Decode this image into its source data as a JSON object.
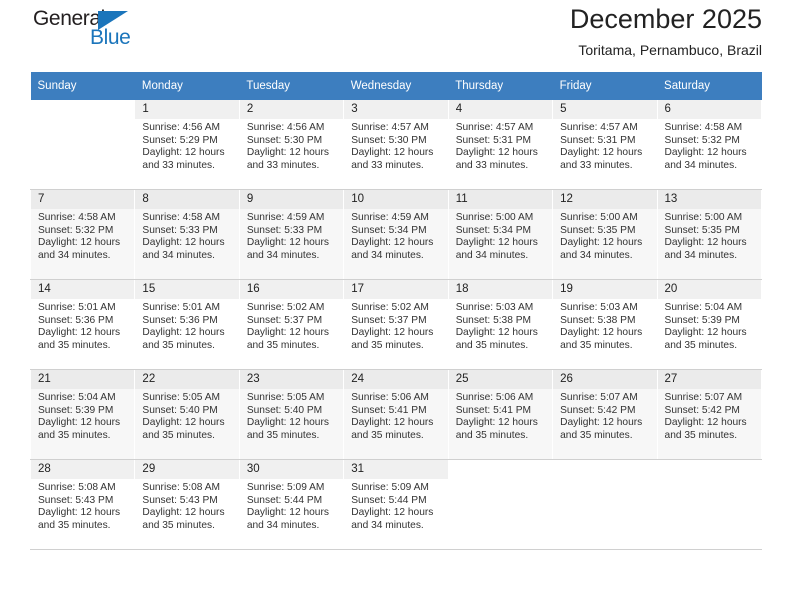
{
  "logo": {
    "word_one": "General",
    "word_two": "Blue",
    "triangle_color": "#1b75bb"
  },
  "header": {
    "title": "December 2025",
    "subtitle": "Toritama, Pernambuco, Brazil"
  },
  "theme": {
    "header_blue": "#3d7ebf",
    "daynum_band": "#f0f0f0",
    "row_shade": "#f7f7f7"
  },
  "labels": {
    "sunrise_prefix": "Sunrise:",
    "sunset_prefix": "Sunset:",
    "daylight_prefix": "Daylight:"
  },
  "weekdays": [
    "Sunday",
    "Monday",
    "Tuesday",
    "Wednesday",
    "Thursday",
    "Friday",
    "Saturday"
  ],
  "weeks": [
    {
      "shaded": false,
      "days": [
        {
          "num": "",
          "sunrise": "",
          "sunset": "",
          "daylight": "",
          "blank": true
        },
        {
          "num": "1",
          "sunrise": "Sunrise: 4:56 AM",
          "sunset": "Sunset: 5:29 PM",
          "daylight": "Daylight: 12 hours and 33 minutes."
        },
        {
          "num": "2",
          "sunrise": "Sunrise: 4:56 AM",
          "sunset": "Sunset: 5:30 PM",
          "daylight": "Daylight: 12 hours and 33 minutes."
        },
        {
          "num": "3",
          "sunrise": "Sunrise: 4:57 AM",
          "sunset": "Sunset: 5:30 PM",
          "daylight": "Daylight: 12 hours and 33 minutes."
        },
        {
          "num": "4",
          "sunrise": "Sunrise: 4:57 AM",
          "sunset": "Sunset: 5:31 PM",
          "daylight": "Daylight: 12 hours and 33 minutes."
        },
        {
          "num": "5",
          "sunrise": "Sunrise: 4:57 AM",
          "sunset": "Sunset: 5:31 PM",
          "daylight": "Daylight: 12 hours and 33 minutes."
        },
        {
          "num": "6",
          "sunrise": "Sunrise: 4:58 AM",
          "sunset": "Sunset: 5:32 PM",
          "daylight": "Daylight: 12 hours and 34 minutes."
        }
      ]
    },
    {
      "shaded": true,
      "days": [
        {
          "num": "7",
          "sunrise": "Sunrise: 4:58 AM",
          "sunset": "Sunset: 5:32 PM",
          "daylight": "Daylight: 12 hours and 34 minutes."
        },
        {
          "num": "8",
          "sunrise": "Sunrise: 4:58 AM",
          "sunset": "Sunset: 5:33 PM",
          "daylight": "Daylight: 12 hours and 34 minutes."
        },
        {
          "num": "9",
          "sunrise": "Sunrise: 4:59 AM",
          "sunset": "Sunset: 5:33 PM",
          "daylight": "Daylight: 12 hours and 34 minutes."
        },
        {
          "num": "10",
          "sunrise": "Sunrise: 4:59 AM",
          "sunset": "Sunset: 5:34 PM",
          "daylight": "Daylight: 12 hours and 34 minutes."
        },
        {
          "num": "11",
          "sunrise": "Sunrise: 5:00 AM",
          "sunset": "Sunset: 5:34 PM",
          "daylight": "Daylight: 12 hours and 34 minutes."
        },
        {
          "num": "12",
          "sunrise": "Sunrise: 5:00 AM",
          "sunset": "Sunset: 5:35 PM",
          "daylight": "Daylight: 12 hours and 34 minutes."
        },
        {
          "num": "13",
          "sunrise": "Sunrise: 5:00 AM",
          "sunset": "Sunset: 5:35 PM",
          "daylight": "Daylight: 12 hours and 34 minutes."
        }
      ]
    },
    {
      "shaded": false,
      "days": [
        {
          "num": "14",
          "sunrise": "Sunrise: 5:01 AM",
          "sunset": "Sunset: 5:36 PM",
          "daylight": "Daylight: 12 hours and 35 minutes."
        },
        {
          "num": "15",
          "sunrise": "Sunrise: 5:01 AM",
          "sunset": "Sunset: 5:36 PM",
          "daylight": "Daylight: 12 hours and 35 minutes."
        },
        {
          "num": "16",
          "sunrise": "Sunrise: 5:02 AM",
          "sunset": "Sunset: 5:37 PM",
          "daylight": "Daylight: 12 hours and 35 minutes."
        },
        {
          "num": "17",
          "sunrise": "Sunrise: 5:02 AM",
          "sunset": "Sunset: 5:37 PM",
          "daylight": "Daylight: 12 hours and 35 minutes."
        },
        {
          "num": "18",
          "sunrise": "Sunrise: 5:03 AM",
          "sunset": "Sunset: 5:38 PM",
          "daylight": "Daylight: 12 hours and 35 minutes."
        },
        {
          "num": "19",
          "sunrise": "Sunrise: 5:03 AM",
          "sunset": "Sunset: 5:38 PM",
          "daylight": "Daylight: 12 hours and 35 minutes."
        },
        {
          "num": "20",
          "sunrise": "Sunrise: 5:04 AM",
          "sunset": "Sunset: 5:39 PM",
          "daylight": "Daylight: 12 hours and 35 minutes."
        }
      ]
    },
    {
      "shaded": true,
      "days": [
        {
          "num": "21",
          "sunrise": "Sunrise: 5:04 AM",
          "sunset": "Sunset: 5:39 PM",
          "daylight": "Daylight: 12 hours and 35 minutes."
        },
        {
          "num": "22",
          "sunrise": "Sunrise: 5:05 AM",
          "sunset": "Sunset: 5:40 PM",
          "daylight": "Daylight: 12 hours and 35 minutes."
        },
        {
          "num": "23",
          "sunrise": "Sunrise: 5:05 AM",
          "sunset": "Sunset: 5:40 PM",
          "daylight": "Daylight: 12 hours and 35 minutes."
        },
        {
          "num": "24",
          "sunrise": "Sunrise: 5:06 AM",
          "sunset": "Sunset: 5:41 PM",
          "daylight": "Daylight: 12 hours and 35 minutes."
        },
        {
          "num": "25",
          "sunrise": "Sunrise: 5:06 AM",
          "sunset": "Sunset: 5:41 PM",
          "daylight": "Daylight: 12 hours and 35 minutes."
        },
        {
          "num": "26",
          "sunrise": "Sunrise: 5:07 AM",
          "sunset": "Sunset: 5:42 PM",
          "daylight": "Daylight: 12 hours and 35 minutes."
        },
        {
          "num": "27",
          "sunrise": "Sunrise: 5:07 AM",
          "sunset": "Sunset: 5:42 PM",
          "daylight": "Daylight: 12 hours and 35 minutes."
        }
      ]
    },
    {
      "shaded": false,
      "days": [
        {
          "num": "28",
          "sunrise": "Sunrise: 5:08 AM",
          "sunset": "Sunset: 5:43 PM",
          "daylight": "Daylight: 12 hours and 35 minutes."
        },
        {
          "num": "29",
          "sunrise": "Sunrise: 5:08 AM",
          "sunset": "Sunset: 5:43 PM",
          "daylight": "Daylight: 12 hours and 35 minutes."
        },
        {
          "num": "30",
          "sunrise": "Sunrise: 5:09 AM",
          "sunset": "Sunset: 5:44 PM",
          "daylight": "Daylight: 12 hours and 34 minutes."
        },
        {
          "num": "31",
          "sunrise": "Sunrise: 5:09 AM",
          "sunset": "Sunset: 5:44 PM",
          "daylight": "Daylight: 12 hours and 34 minutes."
        },
        {
          "num": "",
          "sunrise": "",
          "sunset": "",
          "daylight": "",
          "blank": true
        },
        {
          "num": "",
          "sunrise": "",
          "sunset": "",
          "daylight": "",
          "blank": true
        },
        {
          "num": "",
          "sunrise": "",
          "sunset": "",
          "daylight": "",
          "blank": true
        }
      ]
    }
  ]
}
